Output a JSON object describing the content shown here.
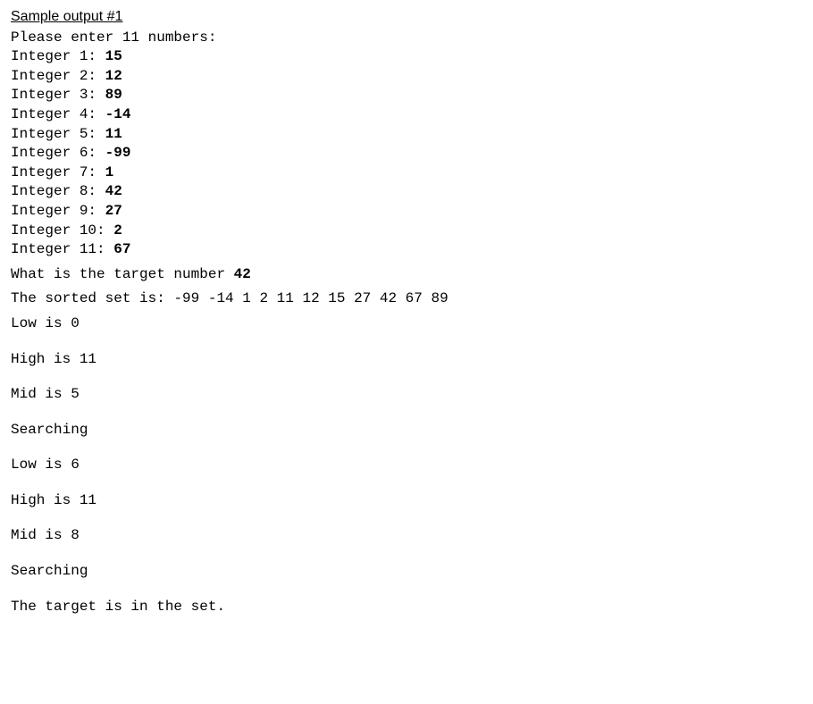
{
  "heading": "Sample output #1",
  "prompt_numbers": "Please enter 11 numbers:",
  "entries": [
    {
      "label": "Integer 1: ",
      "value": "15"
    },
    {
      "label": "Integer 2: ",
      "value": "12"
    },
    {
      "label": "Integer 3: ",
      "value": "89"
    },
    {
      "label": "Integer 4: ",
      "value": "-14"
    },
    {
      "label": "Integer 5: ",
      "value": "11"
    },
    {
      "label": "Integer 6: ",
      "value": "-99"
    },
    {
      "label": "Integer 7: ",
      "value": "1"
    },
    {
      "label": "Integer 8: ",
      "value": "42"
    },
    {
      "label": "Integer 9: ",
      "value": "27"
    },
    {
      "label": "Integer 10: ",
      "value": "2"
    },
    {
      "label": "Integer 11: ",
      "value": "67"
    }
  ],
  "target_prompt": "What is the target number ",
  "target_value": "42",
  "sorted_label": "The sorted set is: ",
  "sorted_values": "-99 -14 1 2 11 12 15 27 42 67 89",
  "steps": [
    "Low is 0",
    "High is 11",
    "Mid is 5",
    "Searching",
    "Low is 6",
    "High is 11",
    "Mid is 8",
    "Searching",
    "The target is in the set."
  ]
}
